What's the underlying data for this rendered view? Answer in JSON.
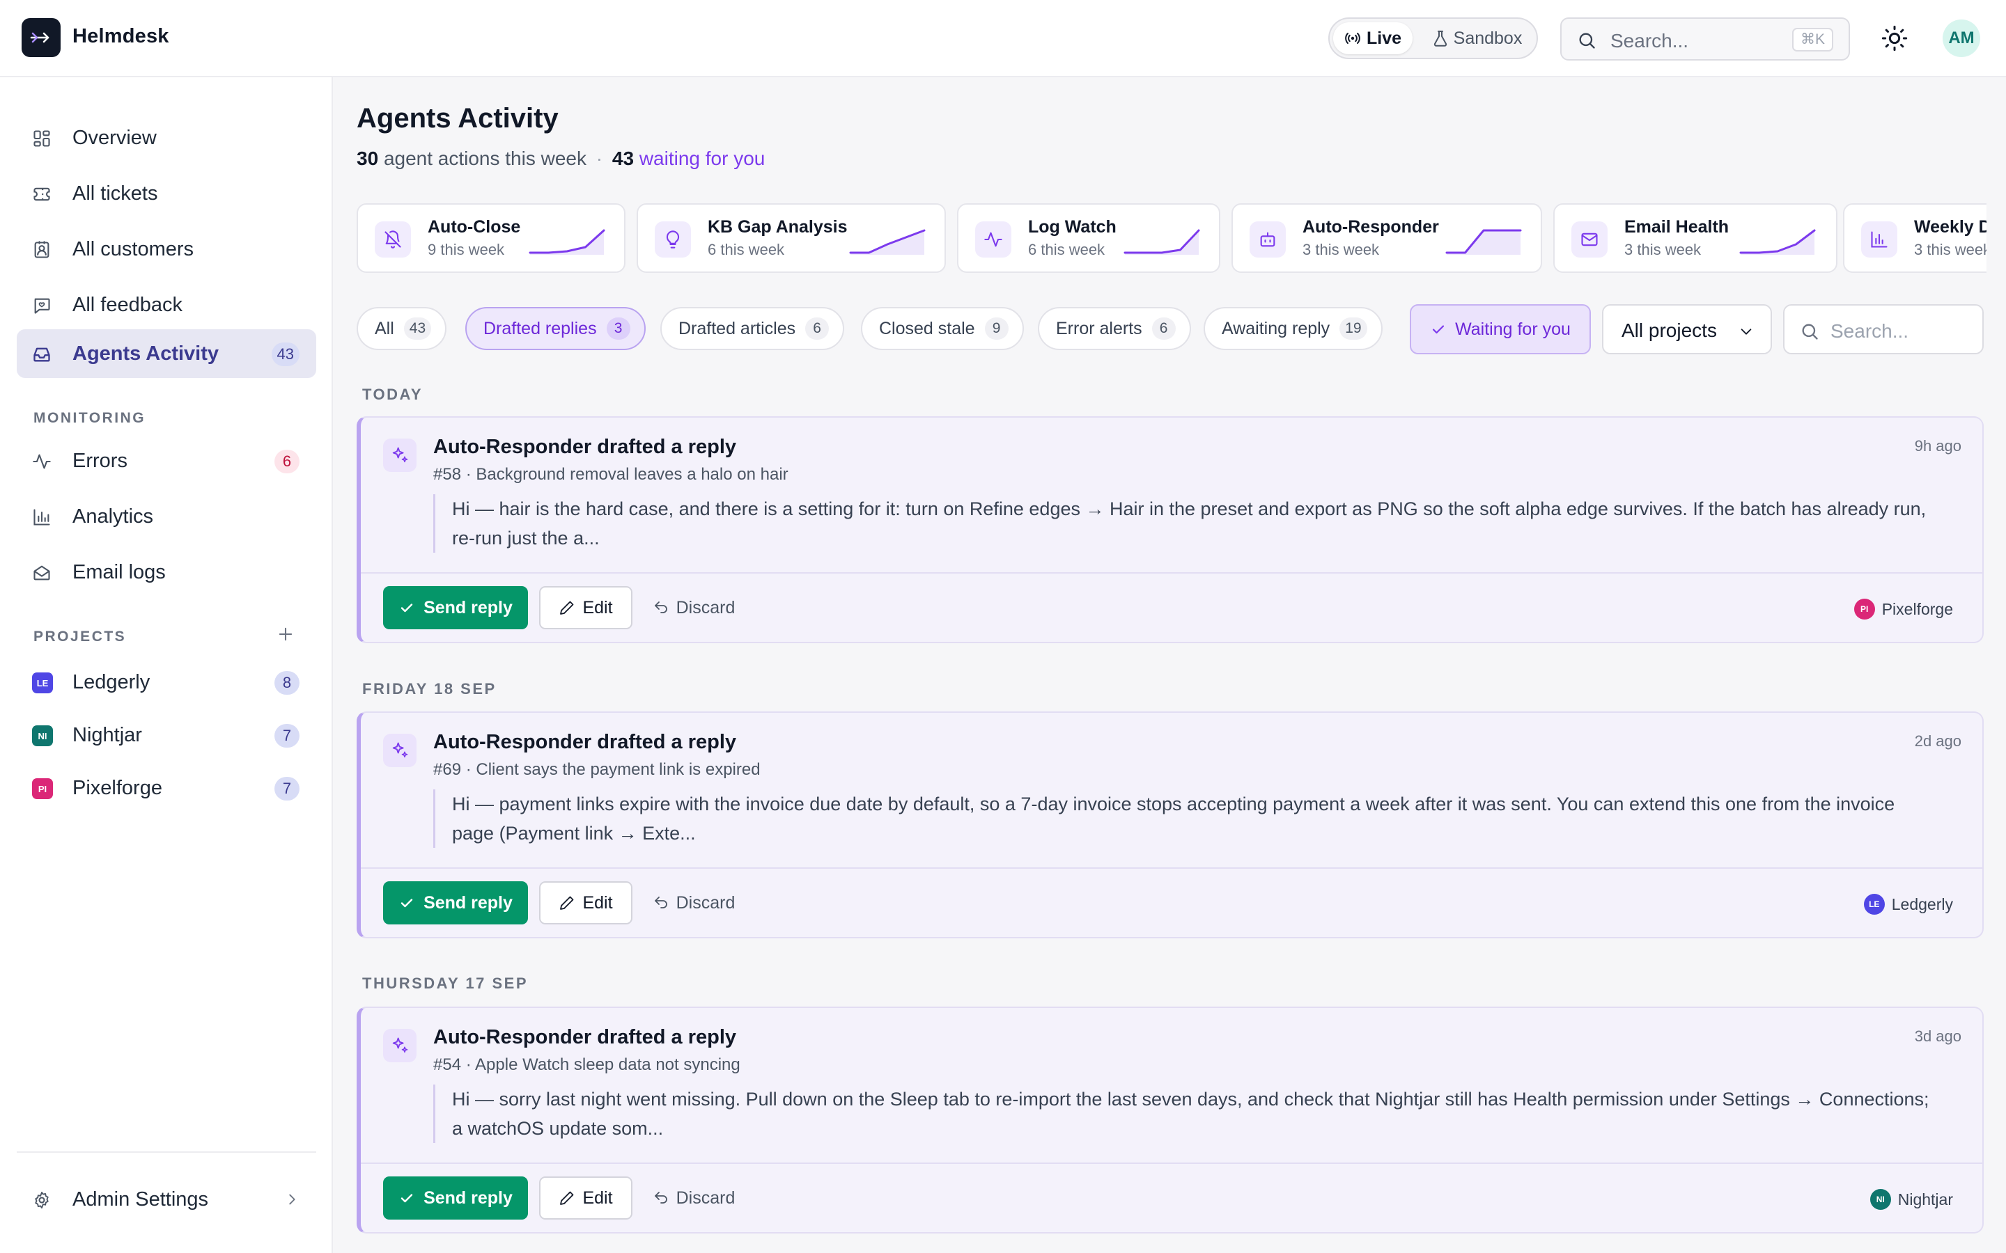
{
  "app": {
    "name": "Helmdesk"
  },
  "topbar": {
    "mode_live": "Live",
    "mode_sandbox": "Sandbox",
    "search_placeholder": "Search...",
    "search_shortcut": "⌘K",
    "user_initials": "AM",
    "icons": [
      "live-signal-icon",
      "flask-icon",
      "search-icon",
      "sun-icon"
    ]
  },
  "sidebar": {
    "nav": [
      {
        "label": "Overview",
        "icon": "layout-dashboard-icon"
      },
      {
        "label": "All tickets",
        "icon": "ticket-icon"
      },
      {
        "label": "All customers",
        "icon": "contact-icon"
      },
      {
        "label": "All feedback",
        "icon": "message-square-icon"
      },
      {
        "label": "Agents Activity",
        "icon": "inbox-icon",
        "count": "43",
        "active": true
      }
    ],
    "monitoring_title": "MONITORING",
    "monitoring": [
      {
        "label": "Errors",
        "icon": "activity-icon",
        "count": "6"
      },
      {
        "label": "Analytics",
        "icon": "bar-chart-icon"
      },
      {
        "label": "Email logs",
        "icon": "mail-open-icon"
      }
    ],
    "projects_title": "PROJECTS",
    "projects": [
      {
        "label": "Ledgerly",
        "badge": "LE",
        "color": "#4f46e5",
        "count": "8"
      },
      {
        "label": "Nightjar",
        "badge": "NI",
        "color": "#0f766e",
        "count": "7"
      },
      {
        "label": "Pixelforge",
        "badge": "PI",
        "color": "#db2777",
        "count": "7"
      }
    ],
    "admin_label": "Admin Settings"
  },
  "main": {
    "title": "Agents Activity",
    "subtitle": {
      "actions_count": "30",
      "actions_text": "agent actions this week",
      "separator": "·",
      "waiting_count": "43",
      "waiting_text": "waiting for you"
    },
    "agents": [
      {
        "name": "Auto-Close",
        "sub": "9 this week",
        "icon": "bell-off-icon",
        "trend": [
          0,
          0,
          0.05,
          0.2,
          0.8
        ]
      },
      {
        "name": "KB Gap Analysis",
        "sub": "6 this week",
        "icon": "lightbulb-icon",
        "trend": [
          0,
          0,
          0.3,
          0.55,
          0.8
        ]
      },
      {
        "name": "Log Watch",
        "sub": "6 this week",
        "icon": "activity-icon",
        "trend": [
          0,
          0,
          0,
          0.1,
          0.8
        ]
      },
      {
        "name": "Auto-Responder",
        "sub": "3 this week",
        "icon": "bot-icon",
        "trend": [
          0,
          0,
          0.8,
          0.8,
          0.8
        ]
      },
      {
        "name": "Email Health",
        "sub": "3 this week",
        "icon": "mail-icon",
        "trend": [
          0,
          0,
          0.05,
          0.3,
          0.8
        ]
      },
      {
        "name": "Weekly Di",
        "sub": "3 this week",
        "icon": "bar-chart-icon",
        "trend": []
      }
    ],
    "filters": [
      {
        "label": "All",
        "count": "43"
      },
      {
        "label": "Drafted replies",
        "count": "3",
        "active": true
      },
      {
        "label": "Drafted articles",
        "count": "6"
      },
      {
        "label": "Closed stale",
        "count": "9"
      },
      {
        "label": "Error alerts",
        "count": "6"
      },
      {
        "label": "Awaiting reply",
        "count": "19"
      }
    ],
    "waiting_toggle": "Waiting for you",
    "project_select": "All projects",
    "filter_search_placeholder": "Search...",
    "groups": [
      {
        "day": "TODAY",
        "title": "Auto-Responder drafted a reply",
        "ref": "#58 · Background removal leaves a halo on hair",
        "time": "9h ago",
        "body": "Hi — hair is the hard case, and there is a setting for it: turn on Refine edges → Hair in the preset and export as PNG so the soft alpha edge survives. If the batch has already run, re-run just the a...",
        "project": "Pixelforge",
        "project_badge": "PI",
        "project_color": "#db2777"
      },
      {
        "day": "FRIDAY 18 SEP",
        "title": "Auto-Responder drafted a reply",
        "ref": "#69 · Client says the payment link is expired",
        "time": "2d ago",
        "body": "Hi — payment links expire with the invoice due date by default, so a 7-day invoice stops accepting payment a week after it was sent. You can extend this one from the invoice page (Payment link → Exte...",
        "project": "Ledgerly",
        "project_badge": "LE",
        "project_color": "#4f46e5"
      },
      {
        "day": "THURSDAY 17 SEP",
        "title": "Auto-Responder drafted a reply",
        "ref": "#54 · Apple Watch sleep data not syncing",
        "time": "3d ago",
        "body": "Hi — sorry last night went missing. Pull down on the Sleep tab to re-import the last seven days, and check that Nightjar still has Health permission under Settings → Connections; a watchOS update som...",
        "project": "Nightjar",
        "project_badge": "NI",
        "project_color": "#0f766e"
      }
    ],
    "actions": {
      "send": "Send reply",
      "edit": "Edit",
      "discard": "Discard"
    }
  },
  "colors": {
    "accent": "#7c3aed",
    "success": "#059669",
    "active_nav_bg": "#e7e7f3"
  }
}
